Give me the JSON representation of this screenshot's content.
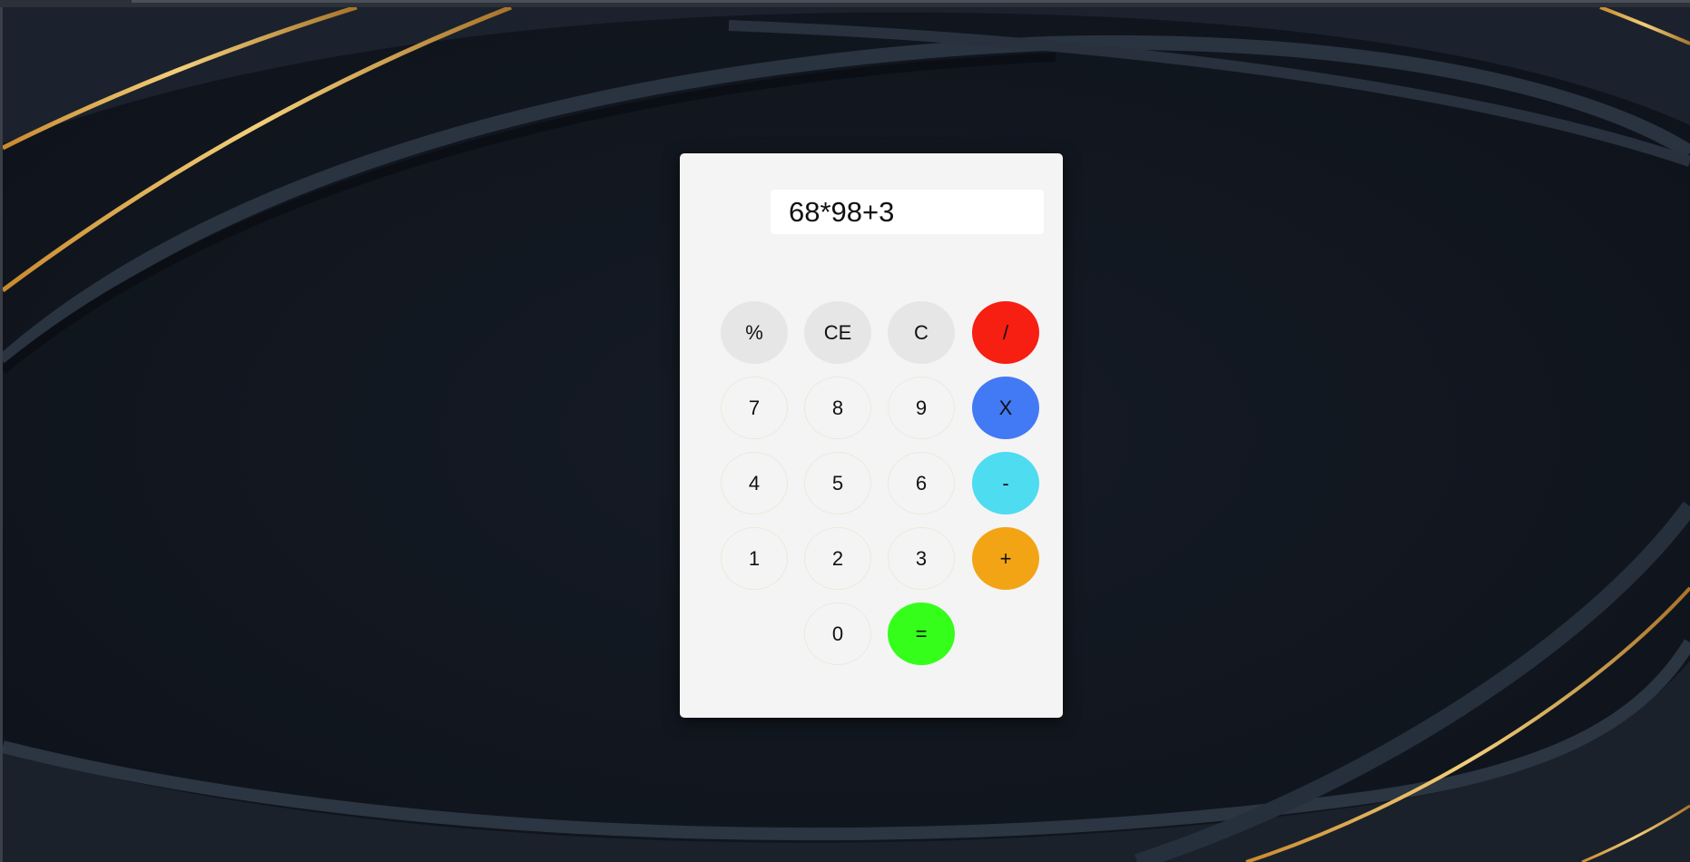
{
  "display": {
    "value": "68*98+3"
  },
  "keys": {
    "percent": "%",
    "ce": "CE",
    "c": "C",
    "divide": "/",
    "seven": "7",
    "eight": "8",
    "nine": "9",
    "multiply": "X",
    "four": "4",
    "five": "5",
    "six": "6",
    "minus": "-",
    "one": "1",
    "two": "2",
    "three": "3",
    "plus": "+",
    "zero": "0",
    "equals": "="
  },
  "colors": {
    "divide": "#f71e12",
    "multiply": "#4279f5",
    "minus": "#4ddcf0",
    "plus": "#f2a414",
    "equals": "#35fe1b",
    "function_keys": "#e6e6e6",
    "background": "#141a24",
    "accent_gold": "#d9a441"
  }
}
